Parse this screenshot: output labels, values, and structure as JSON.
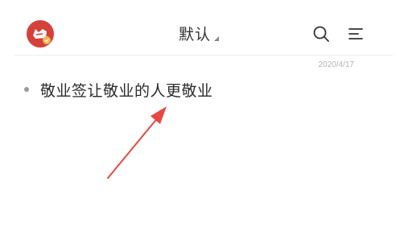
{
  "header": {
    "title": "默认",
    "avatar_icon": "red-cat-badge-icon",
    "search_icon": "search-icon",
    "menu_icon": "menu-icon"
  },
  "note": {
    "date": "2020/4/17",
    "text": "敬业签让敬业的人更敬业"
  },
  "colors": {
    "accent": "#d6403a",
    "arrow": "#e8483f",
    "text": "#2b2b2b",
    "muted": "#b3b3b3"
  }
}
